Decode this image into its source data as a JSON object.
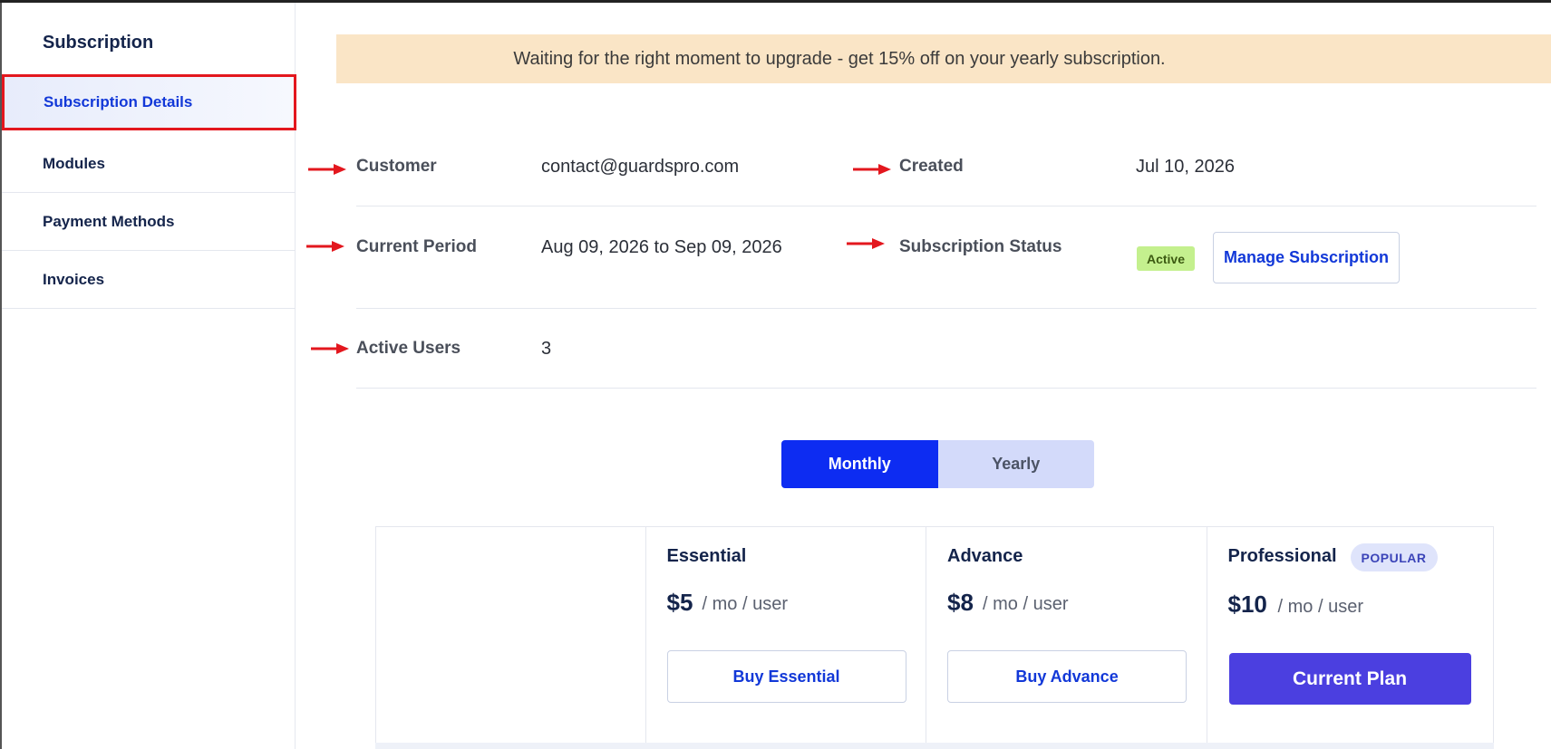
{
  "sidebar": {
    "title": "Subscription",
    "items": [
      {
        "label": "Subscription Details",
        "active": true
      },
      {
        "label": "Modules",
        "active": false
      },
      {
        "label": "Payment Methods",
        "active": false
      },
      {
        "label": "Invoices",
        "active": false
      }
    ]
  },
  "banner": {
    "text": "Waiting for the right moment to upgrade - get 15% off on your yearly subscription."
  },
  "details": {
    "customer": {
      "label": "Customer",
      "value": "contact@guardspro.com"
    },
    "created": {
      "label": "Created",
      "value": "Jul 10, 2026"
    },
    "current_period": {
      "label": "Current Period",
      "value": "Aug 09, 2026 to Sep 09, 2026"
    },
    "status": {
      "label": "Subscription Status",
      "badge": "Active",
      "manage_button": "Manage Subscription"
    },
    "active_users": {
      "label": "Active Users",
      "value": "3"
    }
  },
  "billing_toggle": {
    "monthly": "Monthly",
    "yearly": "Yearly",
    "selected": "Monthly"
  },
  "plans": [
    {
      "name": "Essential",
      "price": "$5",
      "unit": "/ mo / user",
      "button": "Buy Essential"
    },
    {
      "name": "Advance",
      "price": "$8",
      "unit": "/ mo / user",
      "button": "Buy Advance"
    },
    {
      "name": "Professional",
      "price": "$10",
      "unit": "/ mo / user",
      "button": "Current Plan",
      "tag": "POPULAR"
    }
  ],
  "colors": {
    "accent": "#0d2cf2",
    "current_plan": "#4b3fe0",
    "banner_bg": "#fae5c6",
    "active_badge": "#c4f08e",
    "highlight_border": "#e3171e",
    "arrow": "#e3171e"
  },
  "icons": [
    "red-arrow-icon"
  ]
}
